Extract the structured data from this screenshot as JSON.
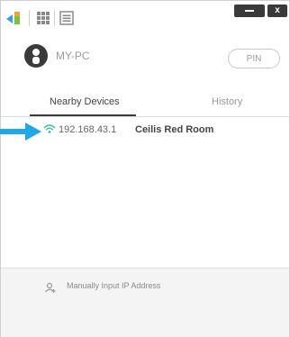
{
  "window": {
    "controls": {
      "minimize_icon": "minimize-icon",
      "close_icon": "close-icon",
      "close_label": "x"
    }
  },
  "toolbar": {
    "icons": [
      "app-logo-icon",
      "grid-icon",
      "list-icon"
    ]
  },
  "device": {
    "name": "MY-PC",
    "pin_label": "PIN",
    "avatar_icon": "user-icon"
  },
  "tabs": [
    {
      "label": "Nearby Devices",
      "active": true
    },
    {
      "label": "History",
      "active": false
    }
  ],
  "devices": [
    {
      "ip": "192.168.43.1",
      "name": "Ceilis Red Room",
      "icon": "wifi-icon"
    }
  ],
  "footer": {
    "manual_ip_label": "Manually Input IP Address",
    "icon": "add-user-icon"
  },
  "colors": {
    "accent_blue": "#22a7e6",
    "wifi_green": "#35c3a0",
    "dark": "#3a3a3a"
  }
}
